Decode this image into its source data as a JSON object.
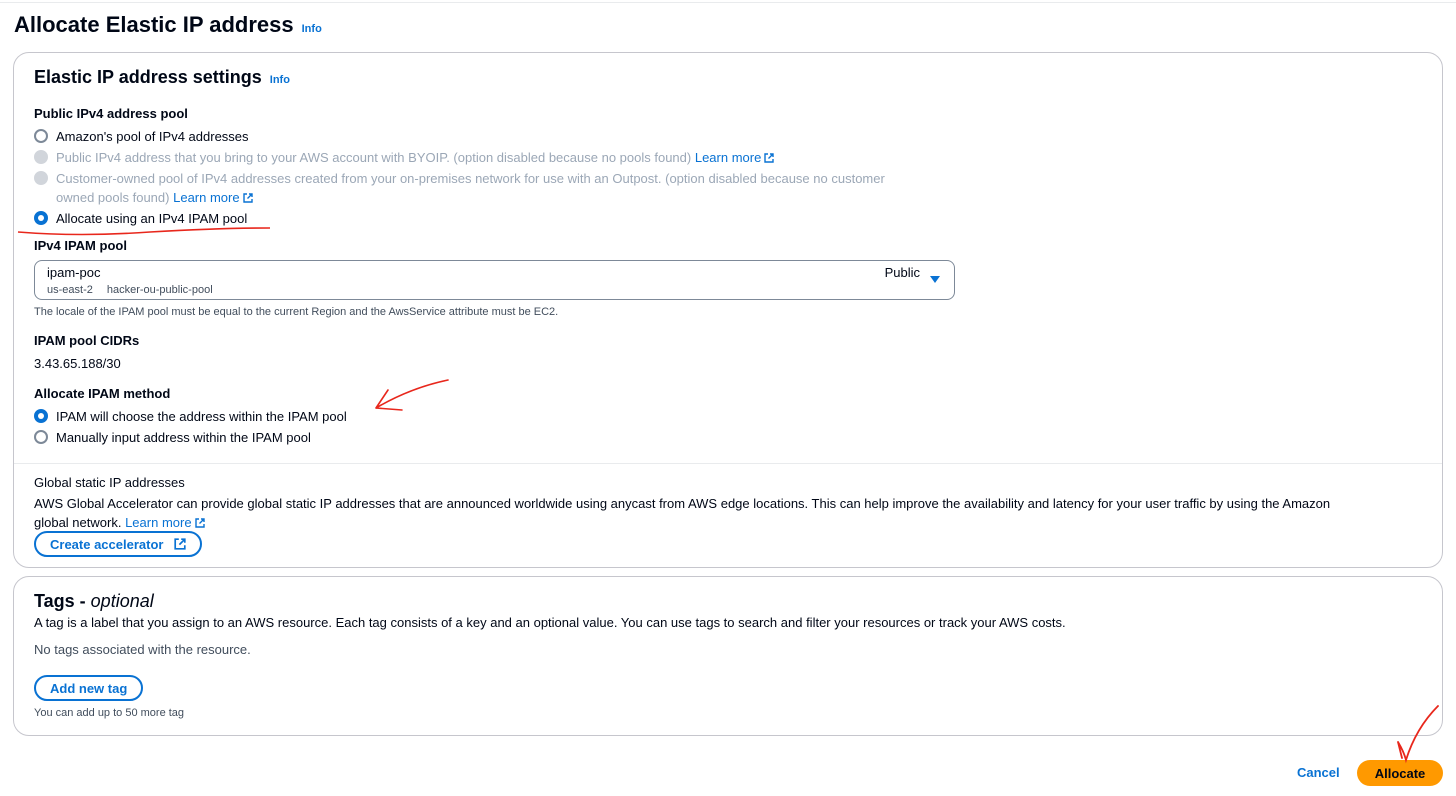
{
  "page": {
    "title": "Allocate Elastic IP address",
    "info": "Info"
  },
  "settings": {
    "title": "Elastic IP address settings",
    "info": "Info",
    "pool_label": "Public IPv4 address pool",
    "options": [
      {
        "label": "Amazon's pool of IPv4 addresses",
        "selected": false,
        "disabled": false
      },
      {
        "label": "Public IPv4 address that you bring to your AWS account with BYOIP. (option disabled because no pools found)",
        "link": "Learn more",
        "selected": false,
        "disabled": true
      },
      {
        "label_line1": "Customer-owned pool of IPv4 addresses created from your on-premises network for use with an Outpost. (option disabled because no customer",
        "label_line2": "owned pools found)",
        "link": "Learn more",
        "selected": false,
        "disabled": true
      },
      {
        "label": "Allocate using an IPv4 IPAM pool",
        "selected": true,
        "disabled": false
      }
    ],
    "ipam_pool": {
      "label": "IPv4 IPAM pool",
      "selected_value": "ipam-poc",
      "region": "us-east-2",
      "pool_name": "hacker-ou-public-pool",
      "visibility": "Public",
      "hint": "The locale of the IPAM pool must be equal to the current Region and the AwsService attribute must be EC2."
    },
    "cidrs": {
      "label": "IPAM pool CIDRs",
      "value": "3.43.65.188/30"
    },
    "method": {
      "label": "Allocate IPAM method",
      "options": [
        {
          "label": "IPAM will choose the address within the IPAM pool",
          "selected": true
        },
        {
          "label": "Manually input address within the IPAM pool",
          "selected": false
        }
      ]
    },
    "global": {
      "title": "Global static IP addresses",
      "description_line1": "AWS Global Accelerator can provide global static IP addresses that are announced worldwide using anycast from AWS edge locations. This can help improve the availability and latency for your user traffic by using the Amazon",
      "description_line2": "global network.",
      "link": "Learn more",
      "button": "Create accelerator"
    }
  },
  "tags": {
    "title": "Tags - ",
    "title_optional": "optional",
    "description": "A tag is a label that you assign to an AWS resource. Each tag consists of a key and an optional value. You can use tags to search and filter your resources or track your AWS costs.",
    "empty": "No tags associated with the resource.",
    "add_button": "Add new tag",
    "limit_hint": "You can add up to 50 more tag"
  },
  "footer": {
    "cancel": "Cancel",
    "submit": "Allocate"
  },
  "colors": {
    "link": "#0972d3",
    "primary_button": "#ff9900",
    "annotation": "#e8271c"
  },
  "icons": [
    "external-link-icon",
    "caret-down-icon",
    "radio-icon"
  ]
}
